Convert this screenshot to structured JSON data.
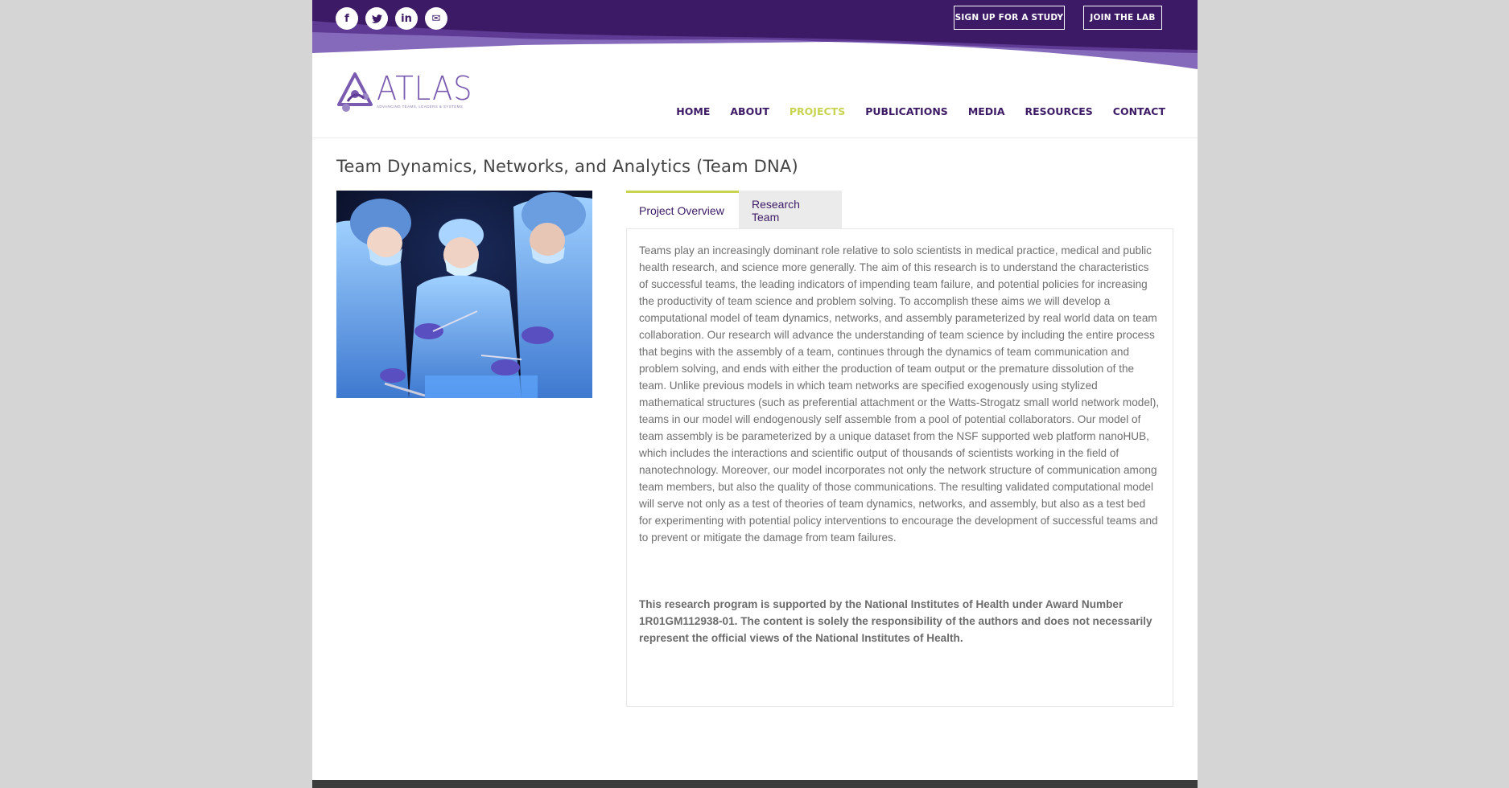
{
  "topbar": {
    "social": [
      {
        "icon": "facebook-icon",
        "glyph": "f"
      },
      {
        "icon": "twitter-icon",
        "glyph": "🐦"
      },
      {
        "icon": "linkedin-icon",
        "glyph": "in"
      },
      {
        "icon": "email-icon",
        "glyph": "✉"
      }
    ],
    "signup_label": "SIGN UP FOR A STUDY",
    "join_label": "JOIN THE LAB"
  },
  "logo": {
    "word": "ATLAS",
    "tagline": "ADVANCING TEAMS, LEADERS & SYSTEMS"
  },
  "nav": {
    "items": [
      "HOME",
      "ABOUT",
      "PROJECTS",
      "PUBLICATIONS",
      "MEDIA",
      "RESOURCES",
      "CONTACT"
    ],
    "active": "PROJECTS"
  },
  "page": {
    "title": "Team Dynamics, Networks, and Analytics (Team DNA)"
  },
  "tabs": {
    "overview_label": "Project Overview",
    "team_label": "Research Team"
  },
  "overview": {
    "paragraph": "Teams play an increasingly dominant role relative to solo scientists in medical practice, medical and public health research, and science more generally. The aim of this research is to understand the characteristics of successful teams, the leading indicators of impending team failure, and potential policies for increasing the productivity of team science and problem solving. To accomplish these aims we will develop a computational model of team dynamics, networks, and assembly parameterized by real world data on team collaboration. Our research will advance the understanding of team science by including the entire process that begins with the assembly of a team, continues through the dynamics of team communication and problem solving, and ends with either the production of team output or the premature dissolution of the team. Unlike previous models in which team networks are specified exogenously using stylized mathematical structures (such as preferential attachment or the Watts-Strogatz small world network model), teams in our model will endogenously self assemble from a pool of potential collaborators. Our model of team assembly is be parameterized by a unique dataset from the NSF supported web platform nanoHUB, which includes the interactions and scientific output of thousands of scientists working in the field of nanotechnology. Moreover, our model incorporates not only the network structure of communication among team members, but also the quality of those communications. The resulting validated computational model will serve not only as a test of theories of team dynamics, networks, and assembly, but also as a test bed for experimenting with potential policy interventions to encourage the development of successful teams and to prevent or mitigate the damage from team failures.",
    "funding": "This research program is supported by the National Institutes of Health under Award Number 1R01GM112938-01. The content is solely the responsibility of the authors and does not necessarily represent the official views of the National Institutes of Health."
  },
  "colors": {
    "brand_purple": "#3d1a66",
    "accent_lime": "#c8d450",
    "text_gray": "#6f6f6f"
  }
}
